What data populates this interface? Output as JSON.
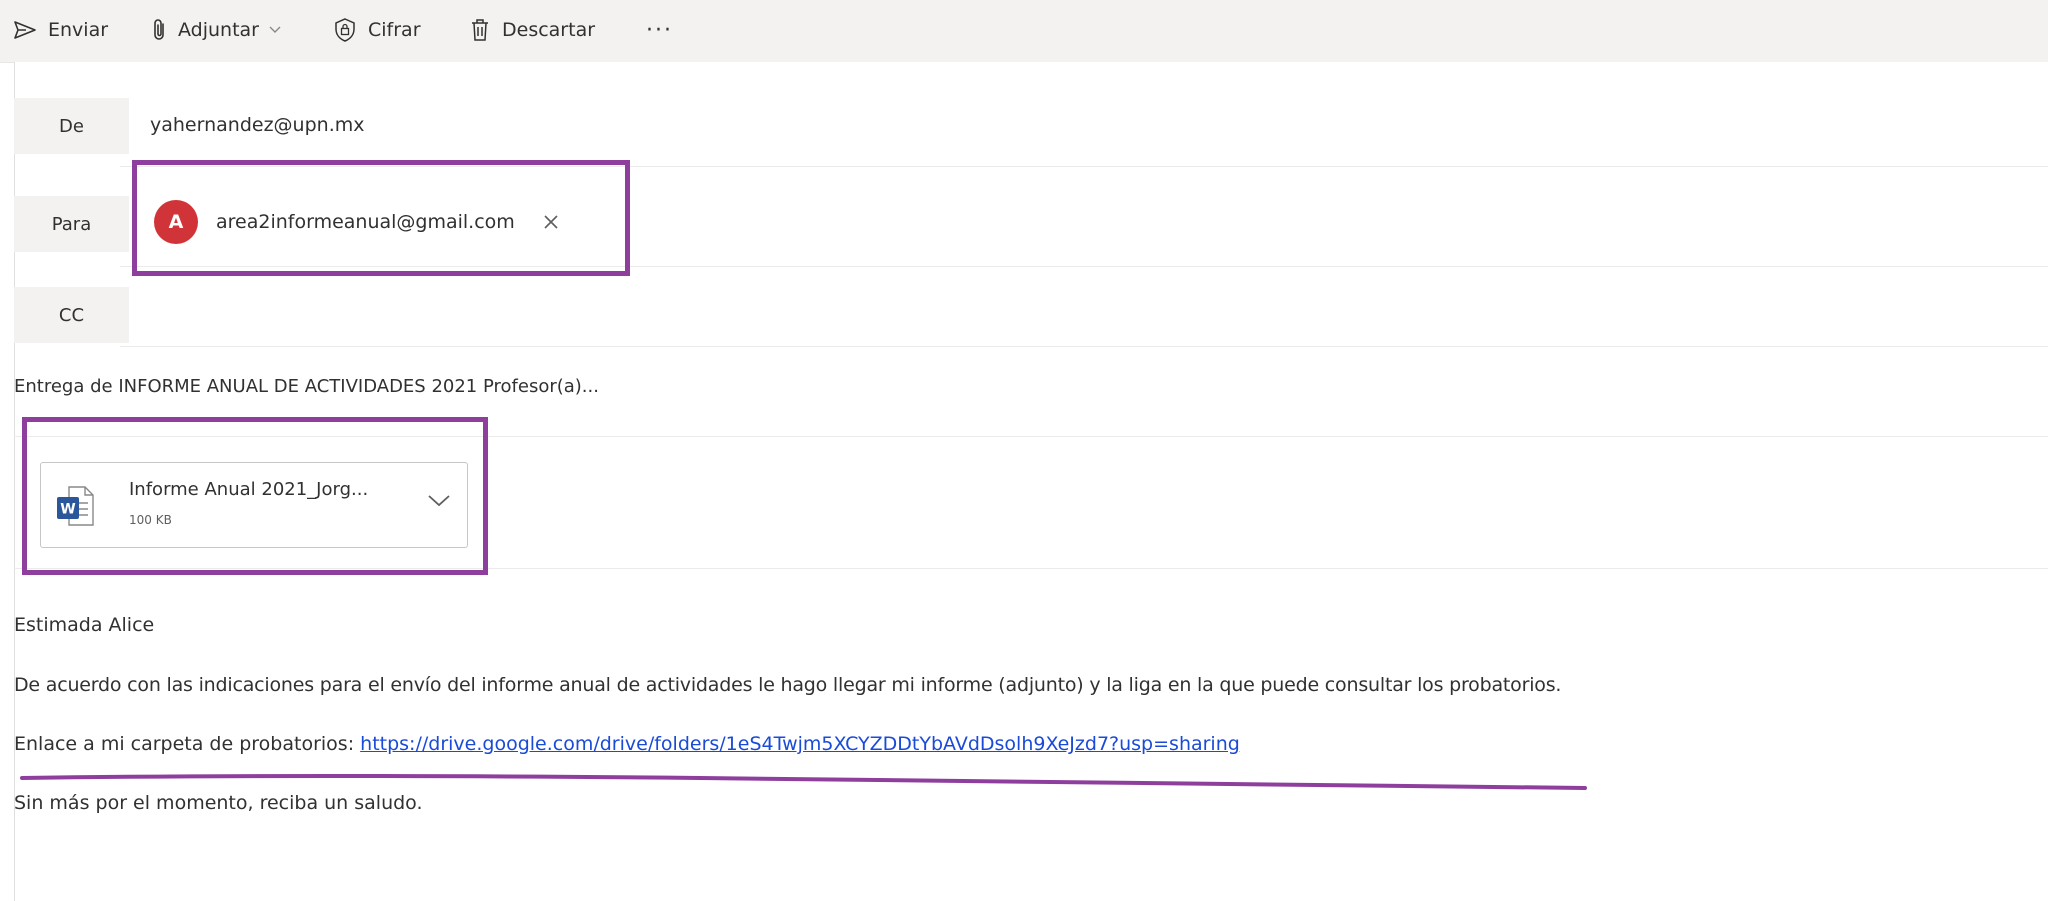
{
  "toolbar": {
    "send_label": "Enviar",
    "attach_label": "Adjuntar",
    "encrypt_label": "Cifrar",
    "discard_label": "Descartar",
    "more_label": "···"
  },
  "from": {
    "label": "De",
    "value": "yahernandez@upn.mx"
  },
  "to": {
    "label": "Para",
    "recipients": [
      {
        "initial": "A",
        "email": "area2informeanual@gmail.com",
        "avatar_color": "#d13438"
      }
    ]
  },
  "cc": {
    "label": "CC"
  },
  "subject": "Entrega de INFORME ANUAL DE ACTIVIDADES 2021 Profesor(a)...",
  "attachment": {
    "name": "Informe Anual 2021_Jorg...",
    "size": "100 KB",
    "icon": "word-icon"
  },
  "body": {
    "greeting": "Estimada Alice",
    "paragraph": "De acuerdo con las indicaciones para el envío del informe anual de actividades le hago llegar mi informe (adjunto) y la liga en la que puede consultar los probatorios.",
    "link_prefix": "Enlace a mi carpeta de probatorios:",
    "link_url": "https://drive.google.com/drive/folders/1eS4Twjm5XCYZDDtYbAVdDsolh9XeJzd7?usp=sharing",
    "closing": "Sin más por el momento, reciba un saludo."
  },
  "colors": {
    "annotation": "#8e3f9e",
    "link": "#1a4bd8",
    "toolbar_bg": "#f3f2f1"
  }
}
